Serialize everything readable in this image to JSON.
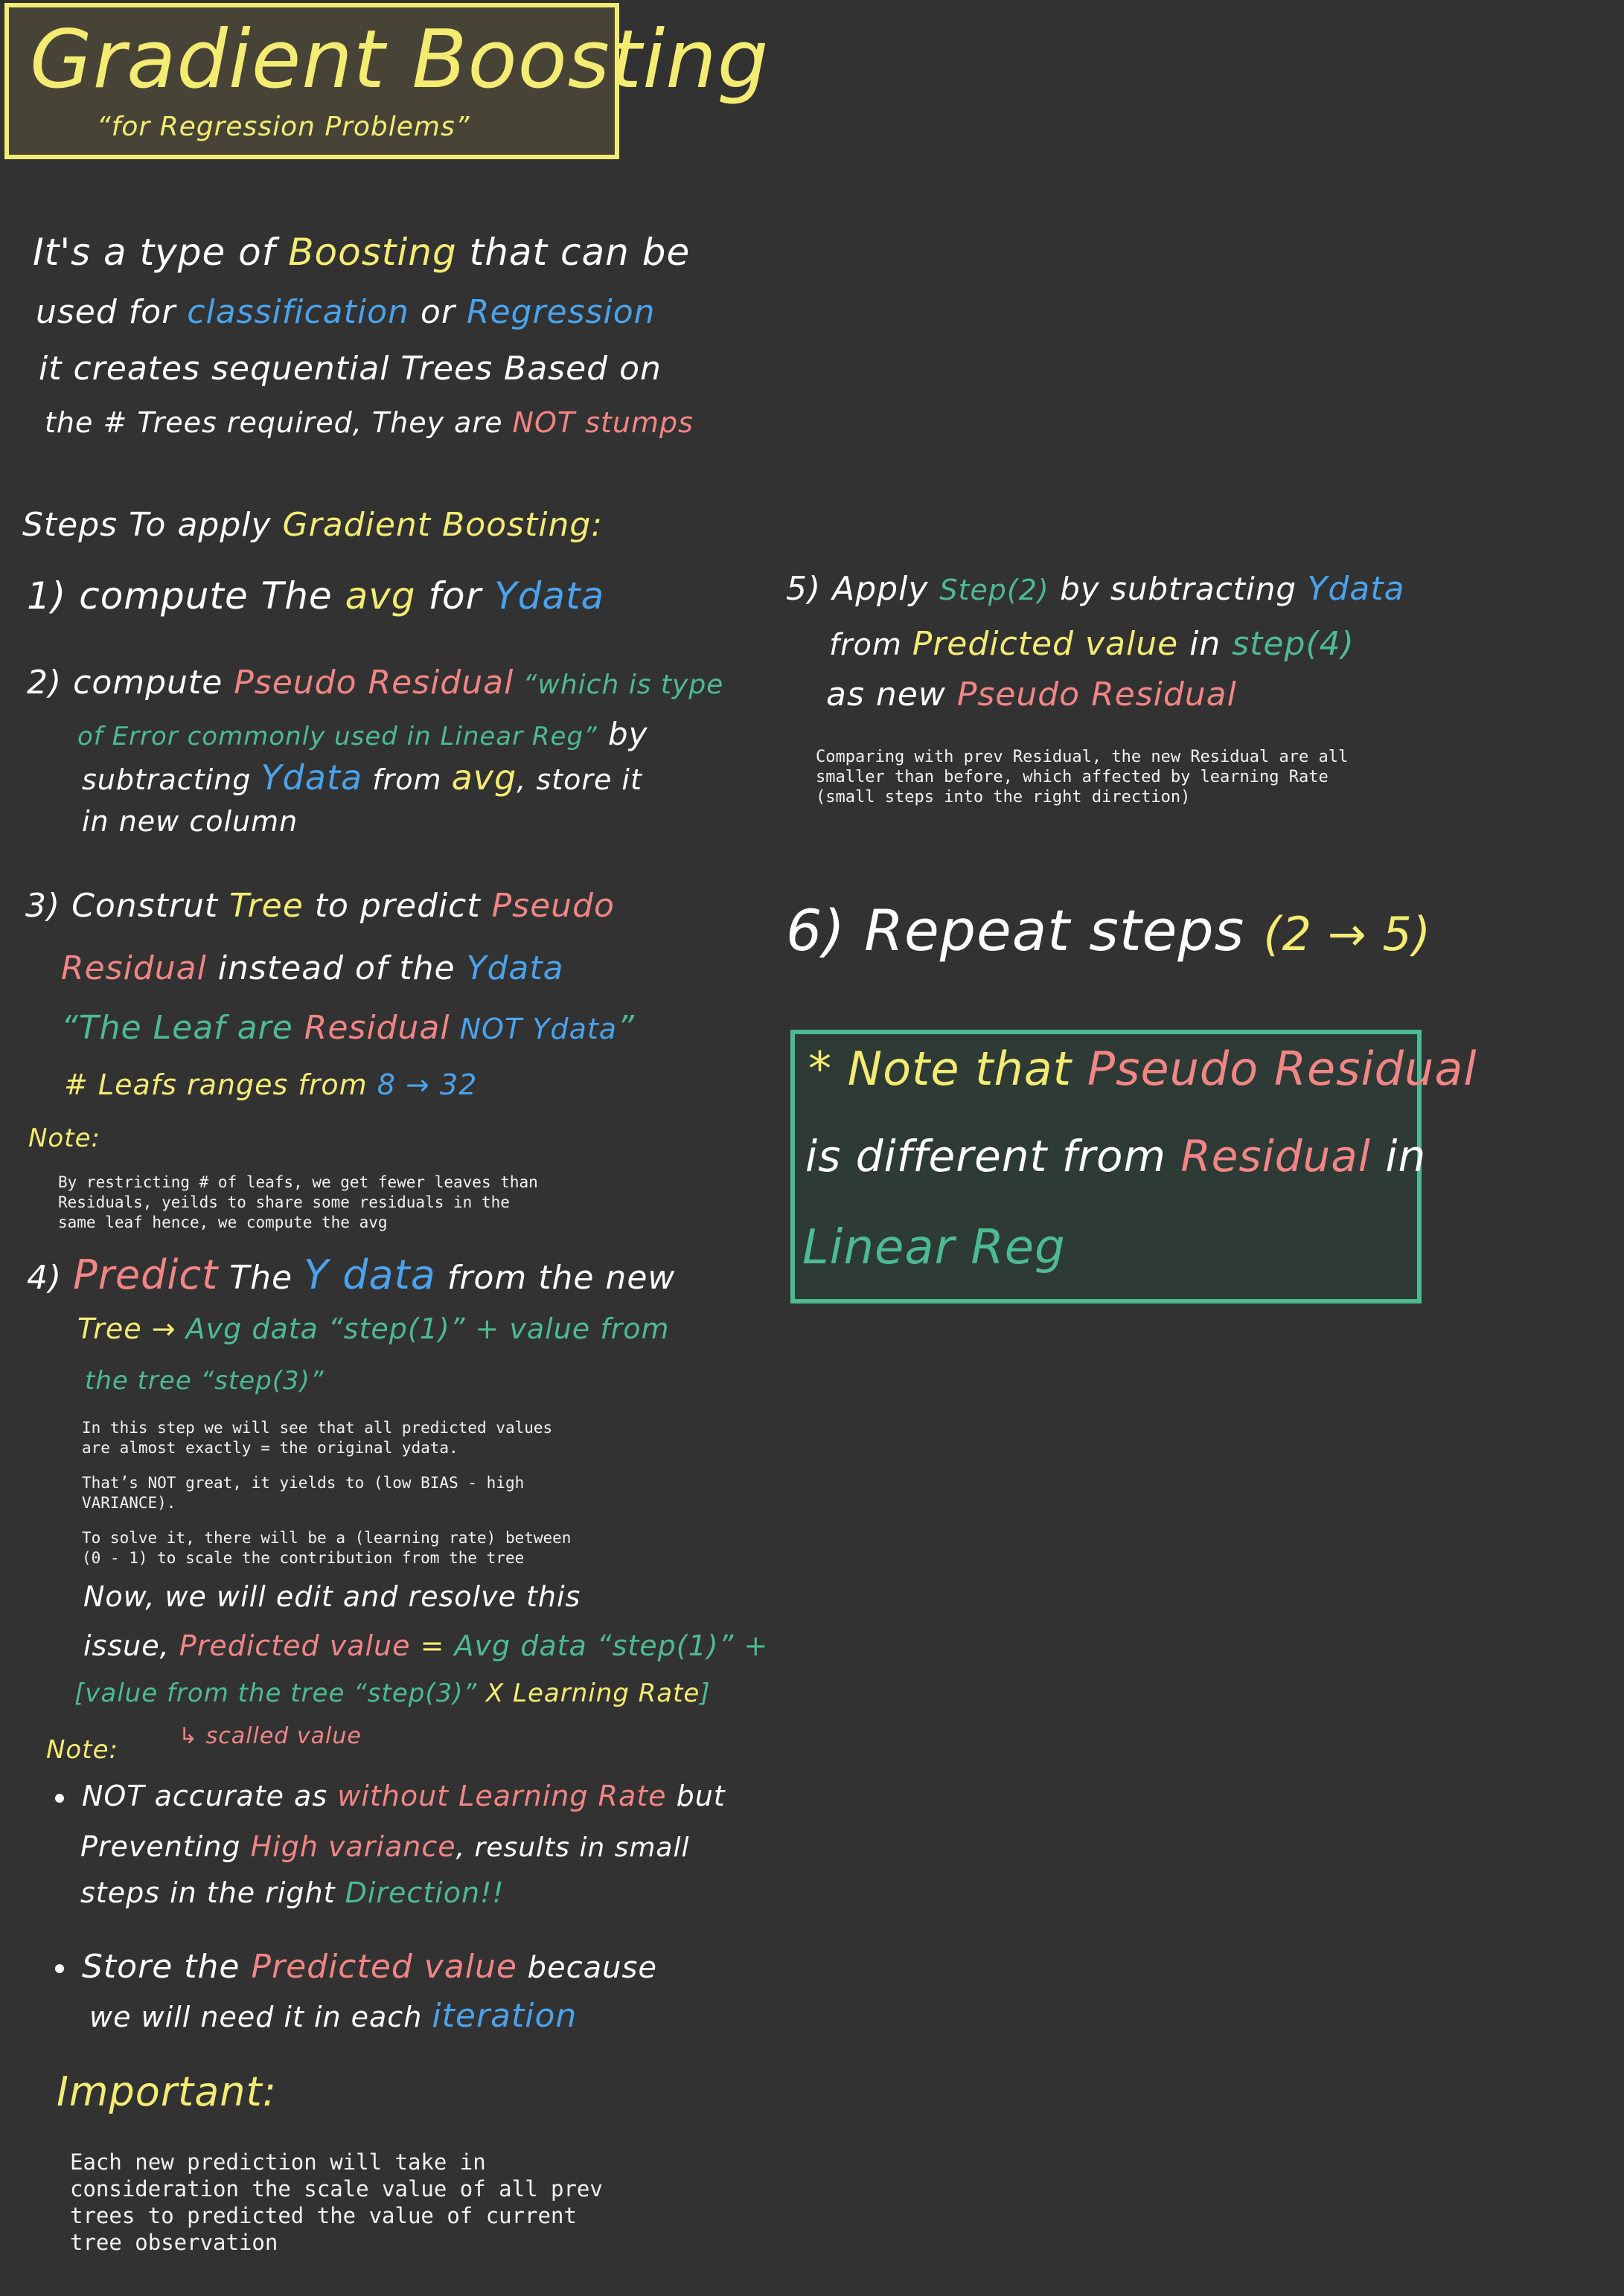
{
  "title": {
    "main": "Gradient Boosting",
    "sub": "“for Regression Problems”"
  },
  "intro": {
    "l1_a": "It's a type of ",
    "l1_b": "Boosting",
    "l1_c": " that can be",
    "l2_a": "used for ",
    "l2_b": "classification",
    "l2_c": " or ",
    "l2_d": "Regression",
    "l3": "it creates sequential Trees Based on",
    "l4_a": "the # Trees required, They are ",
    "l4_b": "NOT stumps"
  },
  "steps_heading": {
    "a": "Steps To apply ",
    "b": "Gradient Boosting:"
  },
  "step1": {
    "a": "1) compute The ",
    "b": "avg",
    "c": " for ",
    "d": "Ydata"
  },
  "step2": {
    "l1_a": "2) compute ",
    "l1_b": "Pseudo Residual",
    "l1_c": " “which is type",
    "l2_a": "of Error commonly used in Linear Reg”",
    "l2_b": " by",
    "l3_a": "subtracting ",
    "l3_b": "Ydata",
    "l3_c": " from ",
    "l3_d": "avg",
    "l3_e": ", store it",
    "l4": "in new column"
  },
  "step3": {
    "l1_a": "3) Construt ",
    "l1_b": "Tree",
    "l1_c": " to predict ",
    "l1_d": "Pseudo",
    "l2_a": "Residual",
    "l2_b": " instead of the ",
    "l2_c": "Ydata",
    "l3_a": "“The Leaf are ",
    "l3_b": "Residual",
    "l3_c": " NOT Ydata",
    "l3_d": "”",
    "l4_a": "# Leafs ranges from ",
    "l4_b": "8 → 32",
    "note_label": "Note:",
    "note_text": "By restricting # of leafs, we get fewer leaves than\nResiduals, yeilds to share some residuals in the\nsame leaf hence, we compute the avg"
  },
  "step4": {
    "l1_a": "4) ",
    "l1_b": "Predict",
    "l1_c": " The ",
    "l1_d": "Y data",
    "l1_e": " from the new",
    "l2_a": "Tree → ",
    "l2_b": "Avg data “step(1)” + value from",
    "l3": "the tree “step(3)”",
    "mono_1": "In this step we will see that all predicted values\nare almost exactly = the original ydata.",
    "mono_2": "That’s NOT great, it yields to (low BIAS - high\nVARIANCE).",
    "mono_3": "To solve it, there will be a (learning rate) between\n(0 - 1) to scale the contribution from the tree",
    "l4": "Now, we will edit and resolve this",
    "l5_a": "issue, ",
    "l5_b": "Predicted value",
    "l5_c": " = ",
    "l5_d": "Avg data “step(1)” +",
    "l6_a": "[value from the tree “step(3)” ",
    "l6_b": "X Learning Rate",
    "l6_c": "]",
    "scaled": "↳ scalled value",
    "note_label": "Note:",
    "b1_l1_a": "NOT accurate as ",
    "b1_l1_b": "without Learning Rate",
    "b1_l1_c": " but",
    "b1_l2_a": "Preventing ",
    "b1_l2_b": "High variance",
    "b1_l2_c": ", results in small",
    "b1_l3_a": "steps in the right ",
    "b1_l3_b": "Direction!!",
    "b2_l1_a": "Store the ",
    "b2_l1_b": "Predicted value",
    "b2_l1_c": " because",
    "b2_l2_a": "we will need it in each ",
    "b2_l2_b": "iteration",
    "important": "Important:",
    "important_text": "Each new prediction will take in\nconsideration the scale value of all prev\ntrees to predicted the value of current\ntree observation"
  },
  "step5": {
    "l1_a": "5) Apply ",
    "l1_b": "Step(2)",
    "l1_c": " by subtracting ",
    "l1_d": "Ydata",
    "l2_a": "from ",
    "l2_b": "Predicted value",
    "l2_c": " in ",
    "l2_d": "step(4)",
    "l3_a": "as new ",
    "l3_b": "Pseudo Residual",
    "mono": "Comparing with prev Residual, the new Residual are all\nsmaller than before, which affected by learning Rate\n(small steps into the right direction)"
  },
  "step6": {
    "a": "6) Repeat steps ",
    "b": "(2 → 5)"
  },
  "note_box": {
    "l1_a": "* Note that ",
    "l1_b": "Pseudo Residual",
    "l2_a": "is different from ",
    "l2_b": "Residual",
    "l2_c": " in",
    "l3": "Linear Reg"
  }
}
